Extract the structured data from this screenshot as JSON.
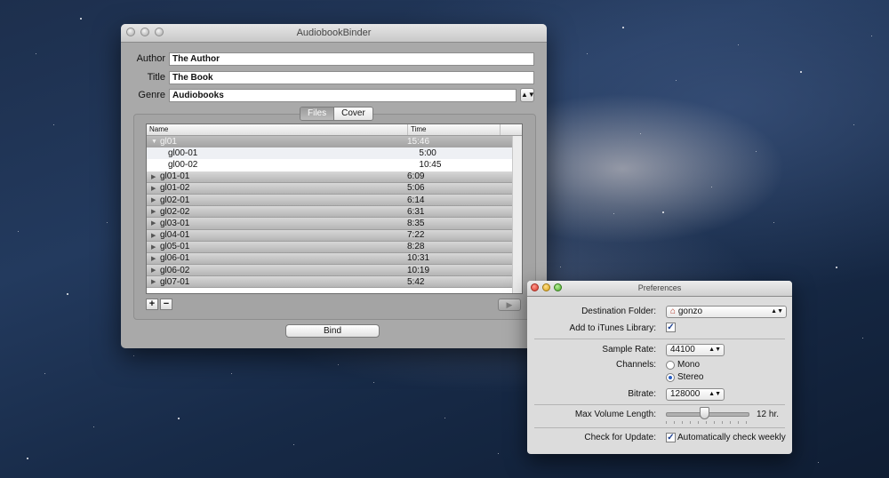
{
  "main_window": {
    "title": "AudiobookBinder",
    "author_label": "Author",
    "author_value": "The Author",
    "title_label": "Title",
    "title_value": "The Book",
    "genre_label": "Genre",
    "genre_value": "Audiobooks",
    "tabs": [
      {
        "label": "Files"
      },
      {
        "label": "Cover"
      }
    ],
    "columns": {
      "name": "Name",
      "time": "Time"
    },
    "rows": [
      {
        "name": "gl01",
        "time": "15:46",
        "kind": "group-open"
      },
      {
        "name": "gl00-01",
        "time": "5:00",
        "kind": "child"
      },
      {
        "name": "gl00-02",
        "time": "10:45",
        "kind": "child"
      },
      {
        "name": "gl01-01",
        "time": "6:09",
        "kind": "group"
      },
      {
        "name": "gl01-02",
        "time": "5:06",
        "kind": "group"
      },
      {
        "name": "gl02-01",
        "time": "6:14",
        "kind": "group"
      },
      {
        "name": "gl02-02",
        "time": "6:31",
        "kind": "group"
      },
      {
        "name": "gl03-01",
        "time": "8:35",
        "kind": "group"
      },
      {
        "name": "gl04-01",
        "time": "7:22",
        "kind": "group"
      },
      {
        "name": "gl05-01",
        "time": "8:28",
        "kind": "group"
      },
      {
        "name": "gl06-01",
        "time": "10:31",
        "kind": "group"
      },
      {
        "name": "gl06-02",
        "time": "10:19",
        "kind": "group"
      },
      {
        "name": "gl07-01",
        "time": "5:42",
        "kind": "group"
      }
    ],
    "add_label": "+",
    "remove_label": "−",
    "play_label": "▶",
    "bind_label": "Bind"
  },
  "prefs_window": {
    "title": "Preferences",
    "destination_label": "Destination Folder:",
    "destination_value": "gonzo",
    "itunes_label": "Add to iTunes Library:",
    "itunes_checked": true,
    "sample_rate_label": "Sample Rate:",
    "sample_rate_value": "44100",
    "channels_label": "Channels:",
    "channel_options": [
      "Mono",
      "Stereo"
    ],
    "channel_selected": "Stereo",
    "bitrate_label": "Bitrate:",
    "bitrate_value": "128000",
    "max_volume_label": "Max Volume Length:",
    "max_volume_value": "12 hr.",
    "max_volume_fraction": 0.47,
    "update_label": "Check for Update:",
    "update_option_label": "Automatically check weekly",
    "update_checked": true
  },
  "icons": {
    "disclosure_closed": "▶",
    "disclosure_open": "▼",
    "popup_arrows": "▲▼",
    "home": "⌂",
    "checkmark": "✓"
  }
}
